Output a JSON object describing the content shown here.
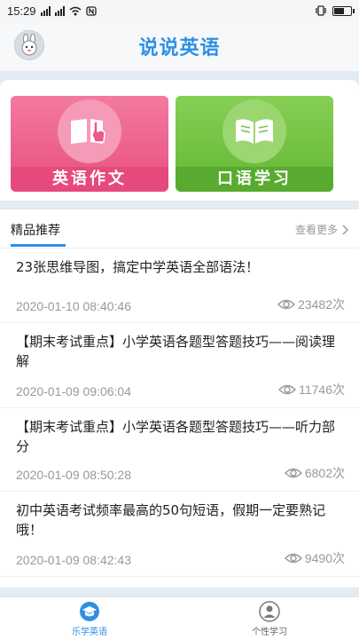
{
  "status_bar": {
    "time": "15:29",
    "battery_level": 0.7
  },
  "header": {
    "title": "说说英语"
  },
  "categories": [
    {
      "label": "英语作文",
      "icon": "book-hand-icon",
      "color": "#ef6a93"
    },
    {
      "label": "口语学习",
      "icon": "open-book-icon",
      "color": "#78c447"
    }
  ],
  "section": {
    "title": "精品推荐",
    "more_label": "查看更多"
  },
  "articles": [
    {
      "title": "23张思维导图，搞定中学英语全部语法！",
      "date": "2020-01-10 08:40:46",
      "views": "23482次"
    },
    {
      "title": "【期末考试重点】小学英语各题型答题技巧——阅读理解",
      "date": "2020-01-09 09:06:04",
      "views": "11746次"
    },
    {
      "title": "【期末考试重点】小学英语各题型答题技巧——听力部分",
      "date": "2020-01-09 08:50:28",
      "views": "6802次"
    },
    {
      "title": "初中英语考试频率最高的50句短语，假期一定要熟记哦！",
      "date": "2020-01-09 08:42:43",
      "views": "9490次"
    }
  ],
  "tabbar": {
    "home_label": "乐学英语",
    "personal_label": "个性学习",
    "accent": "#2f8fe6"
  }
}
